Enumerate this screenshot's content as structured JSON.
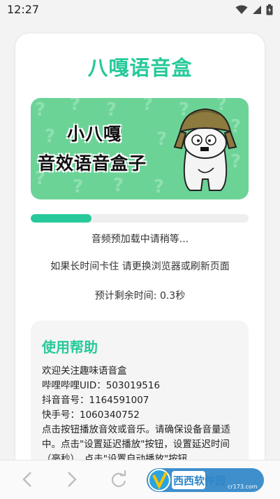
{
  "status": {
    "time": "12:27"
  },
  "app": {
    "title": "八嘎语音盒"
  },
  "banner": {
    "line1": "小八嘎",
    "line2": "音效语音盒子"
  },
  "progress": {
    "fraction": 0.28
  },
  "messages": {
    "loading": "音频预加载中请稍等...",
    "stuck_hint": "如果长时间卡住 请更换浏览器或刷新页面",
    "remaining": "预计剩余时间: 0.3秒"
  },
  "help": {
    "title": "使用帮助",
    "lines": [
      "欢迎关注趣味语音盒",
      "哔哩哔哩UID：503019516",
      "抖音音号：1164591007",
      "快手号：1060340752",
      "点击按钮播放音效或音乐。请确保设备音量适中。点击\"设置延迟播放\"按钮，设置延迟时间（毫秒）。点击\"设置自动播放\"按钮"
    ]
  },
  "watermark": {
    "text": "西西软件园",
    "sub": "cr173.com"
  },
  "colors": {
    "accent": "#27c99a",
    "banner_bg": "#6cd397"
  },
  "icons": [
    "wifi-icon",
    "signal-icon",
    "battery-icon",
    "back-icon",
    "forward-icon",
    "reload-icon"
  ]
}
